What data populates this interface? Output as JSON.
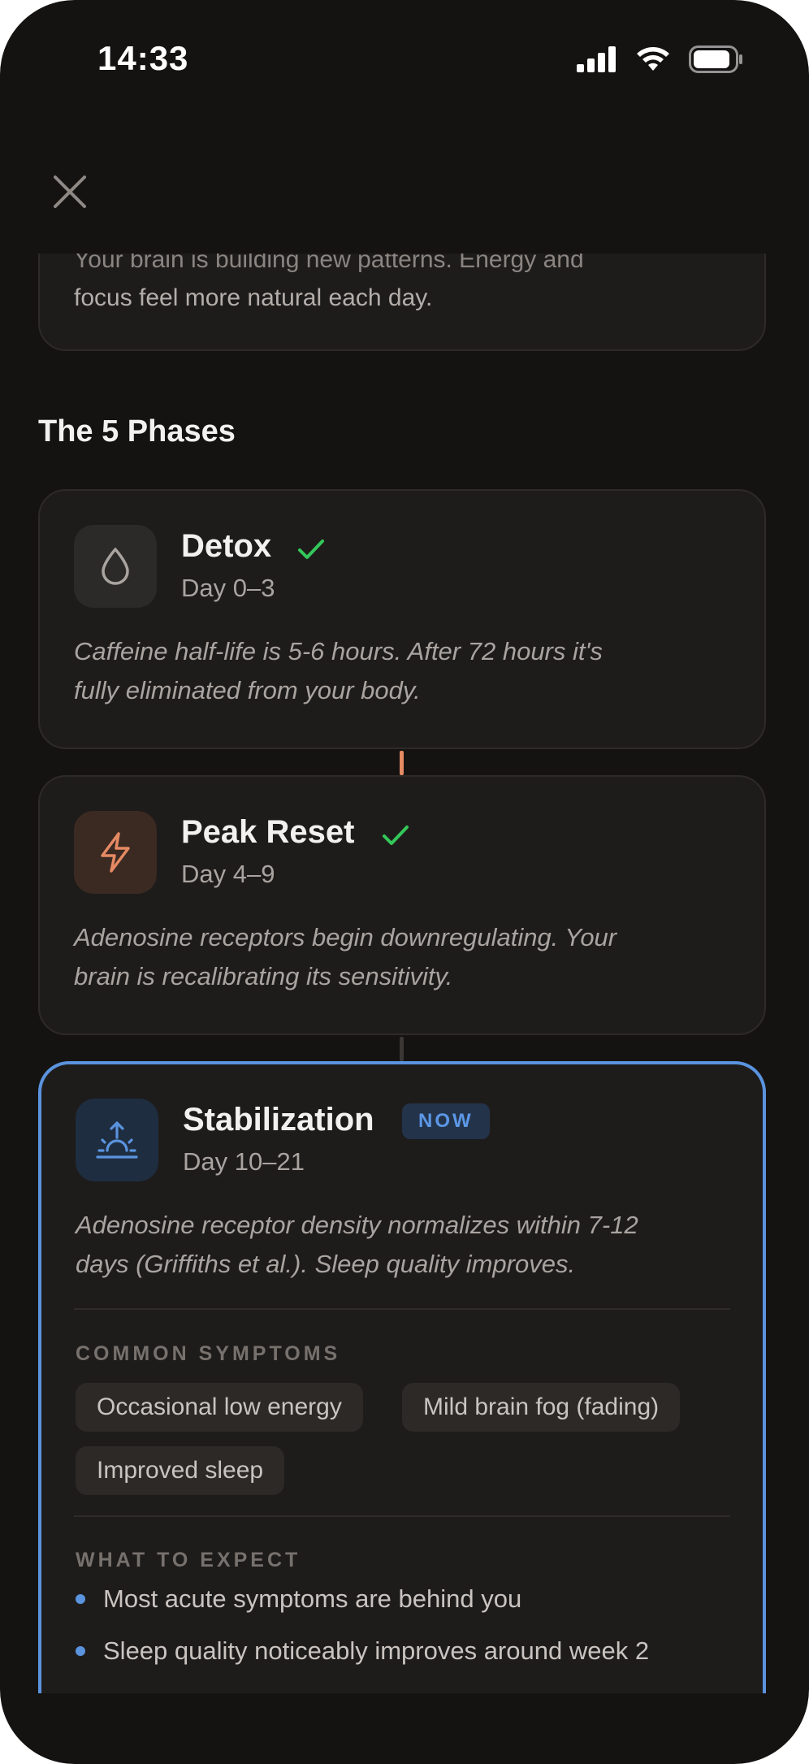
{
  "status_bar": {
    "time": "14:33"
  },
  "intro": {
    "partial_line": "Your brain is building new patterns. Energy and",
    "line2": "focus feel more natural each day."
  },
  "section_title": "The 5 Phases",
  "phases": [
    {
      "name": "Detox",
      "days": "Day 0–3",
      "desc1": "Caffeine half-life is 5-6 hours. After 72 hours it's",
      "desc2": "fully eliminated from your body.",
      "completed": true,
      "icon": "droplet-icon"
    },
    {
      "name": "Peak Reset",
      "days": "Day 4–9",
      "desc1": "Adenosine receptors begin downregulating. Your",
      "desc2": "brain is recalibrating its sensitivity.",
      "completed": true,
      "icon": "lightning-icon"
    },
    {
      "name": "Stabilization",
      "days": "Day 10–21",
      "badge": "NOW",
      "desc1": "Adenosine receptor density normalizes within 7-12",
      "desc2": "days (Griffiths et al.). Sleep quality improves.",
      "icon": "sunrise-icon",
      "symptoms_label": "COMMON SYMPTOMS",
      "symptoms": [
        "Occasional low energy",
        "Mild brain fog (fading)",
        "Improved sleep"
      ],
      "expect_label": "WHAT TO EXPECT",
      "expect": [
        "Most acute symptoms are behind you",
        "Sleep quality noticeably improves around week 2"
      ]
    }
  ],
  "colors": {
    "background": "#151312",
    "card": "#1e1c1b",
    "check": "#34c759",
    "accent_orange": "#e58a63",
    "accent_blue": "#5a93de"
  }
}
